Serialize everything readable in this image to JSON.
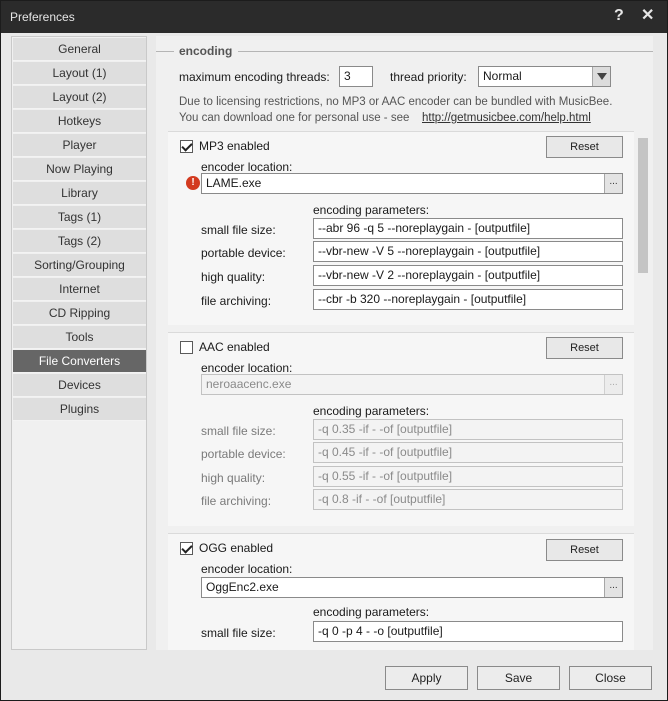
{
  "window": {
    "title": "Preferences",
    "help_glyph": "?",
    "close_glyph": "✕"
  },
  "sidebar": {
    "items": [
      {
        "label": "General"
      },
      {
        "label": "Layout (1)"
      },
      {
        "label": "Layout (2)"
      },
      {
        "label": "Hotkeys"
      },
      {
        "label": "Player"
      },
      {
        "label": "Now Playing"
      },
      {
        "label": "Library"
      },
      {
        "label": "Tags (1)"
      },
      {
        "label": "Tags (2)"
      },
      {
        "label": "Sorting/Grouping"
      },
      {
        "label": "Internet"
      },
      {
        "label": "CD Ripping"
      },
      {
        "label": "Tools"
      },
      {
        "label": "File Converters"
      },
      {
        "label": "Devices"
      },
      {
        "label": "Plugins"
      }
    ],
    "active": "File Converters"
  },
  "encoding": {
    "section_title": "encoding",
    "threads_label": "maximum encoding threads:",
    "threads_value": "3",
    "priority_label": "thread priority:",
    "priority_value": "Normal",
    "note_line1": "Due to licensing restrictions, no MP3 or AAC encoder can be bundled with MusicBee.",
    "note_line2": "You can download one for personal use - see",
    "note_link": "http://getmusicbee.com/help.html"
  },
  "encoders": [
    {
      "enabled_label": "MP3 enabled",
      "enabled": true,
      "reset_label": "Reset",
      "location_label": "encoder location:",
      "location_value": "LAME.exe",
      "browse_label": "...",
      "warning_glyph": "!",
      "params_label": "encoding parameters:",
      "params": [
        {
          "label": "small file size:",
          "value": "--abr 96 -q 5 --noreplaygain - [outputfile]"
        },
        {
          "label": "portable device:",
          "value": "--vbr-new -V 5 --noreplaygain - [outputfile]"
        },
        {
          "label": "high quality:",
          "value": "--vbr-new -V 2 --noreplaygain - [outputfile]"
        },
        {
          "label": "file archiving:",
          "value": "--cbr -b 320 --noreplaygain - [outputfile]"
        }
      ]
    },
    {
      "enabled_label": "AAC enabled",
      "enabled": false,
      "reset_label": "Reset",
      "location_label": "encoder location:",
      "location_value": "neroaacenc.exe",
      "browse_label": "...",
      "params_label": "encoding parameters:",
      "params": [
        {
          "label": "small file size:",
          "value": "-q 0.35 -if - -of [outputfile]"
        },
        {
          "label": "portable device:",
          "value": "-q 0.45 -if - -of [outputfile]"
        },
        {
          "label": "high quality:",
          "value": "-q 0.55 -if - -of [outputfile]"
        },
        {
          "label": "file archiving:",
          "value": "-q 0.8 -if - -of [outputfile]"
        }
      ]
    },
    {
      "enabled_label": "OGG enabled",
      "enabled": true,
      "reset_label": "Reset",
      "location_label": "encoder location:",
      "location_value": "OggEnc2.exe",
      "browse_label": "...",
      "params_label": "encoding parameters:",
      "params": [
        {
          "label": "small file size:",
          "value": "-q 0 -p 4 - -o [outputfile]"
        }
      ]
    }
  ],
  "buttons": {
    "apply": "Apply",
    "save": "Save",
    "close": "Close"
  },
  "colors": {
    "titlebar": "#2b2b2b",
    "active_sidebar": "#666666",
    "warning": "#d33a1f"
  }
}
